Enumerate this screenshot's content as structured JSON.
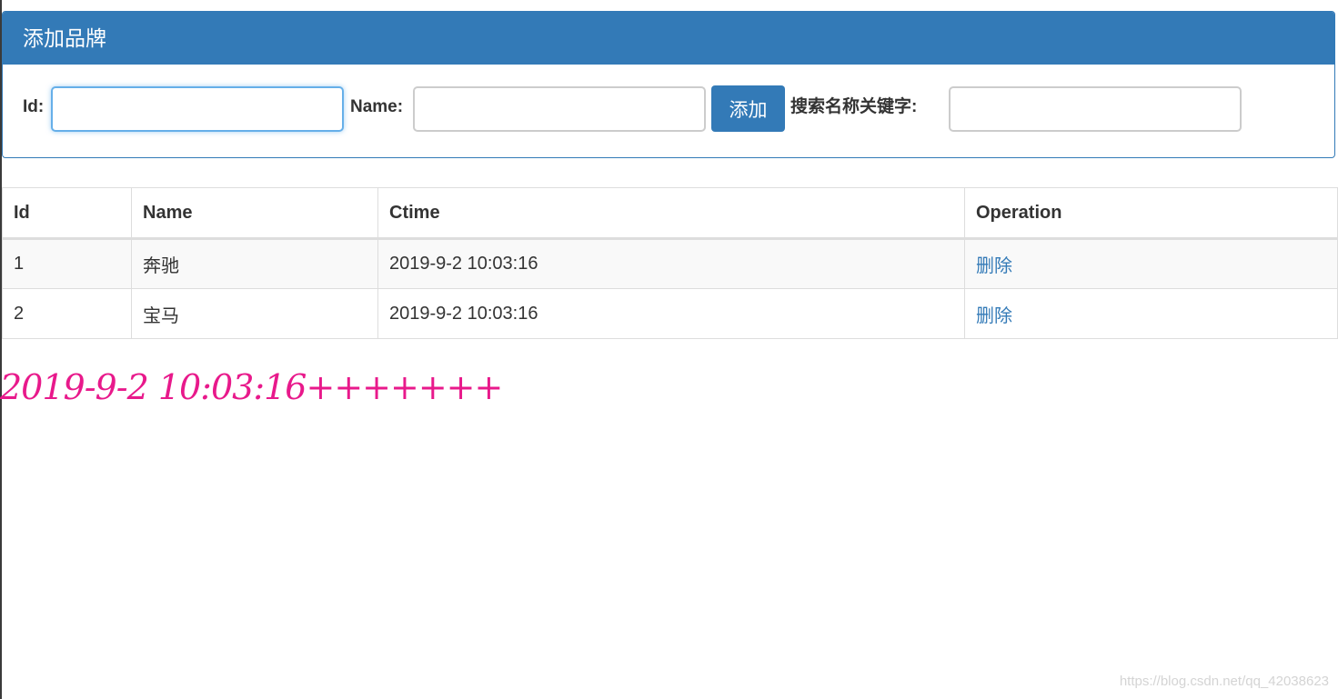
{
  "panel": {
    "title": "添加品牌",
    "id_label": "Id:",
    "id_value": "",
    "name_label": "Name:",
    "name_value": "",
    "add_button": "添加",
    "search_label": "搜索名称关键字:",
    "search_value": ""
  },
  "table": {
    "headers": [
      "Id",
      "Name",
      "Ctime",
      "Operation"
    ],
    "rows": [
      {
        "id": "1",
        "name": "奔驰",
        "ctime": "2019-9-2 10:03:16",
        "op": "删除"
      },
      {
        "id": "2",
        "name": "宝马",
        "ctime": "2019-9-2 10:03:16",
        "op": "删除"
      }
    ]
  },
  "time_display": "2019-9-2 10:03:16+++++++",
  "watermark": "https://blog.csdn.net/qq_42038623",
  "colors": {
    "primary": "#337ab7",
    "time_text": "#e8198b",
    "border": "#dddddd"
  }
}
